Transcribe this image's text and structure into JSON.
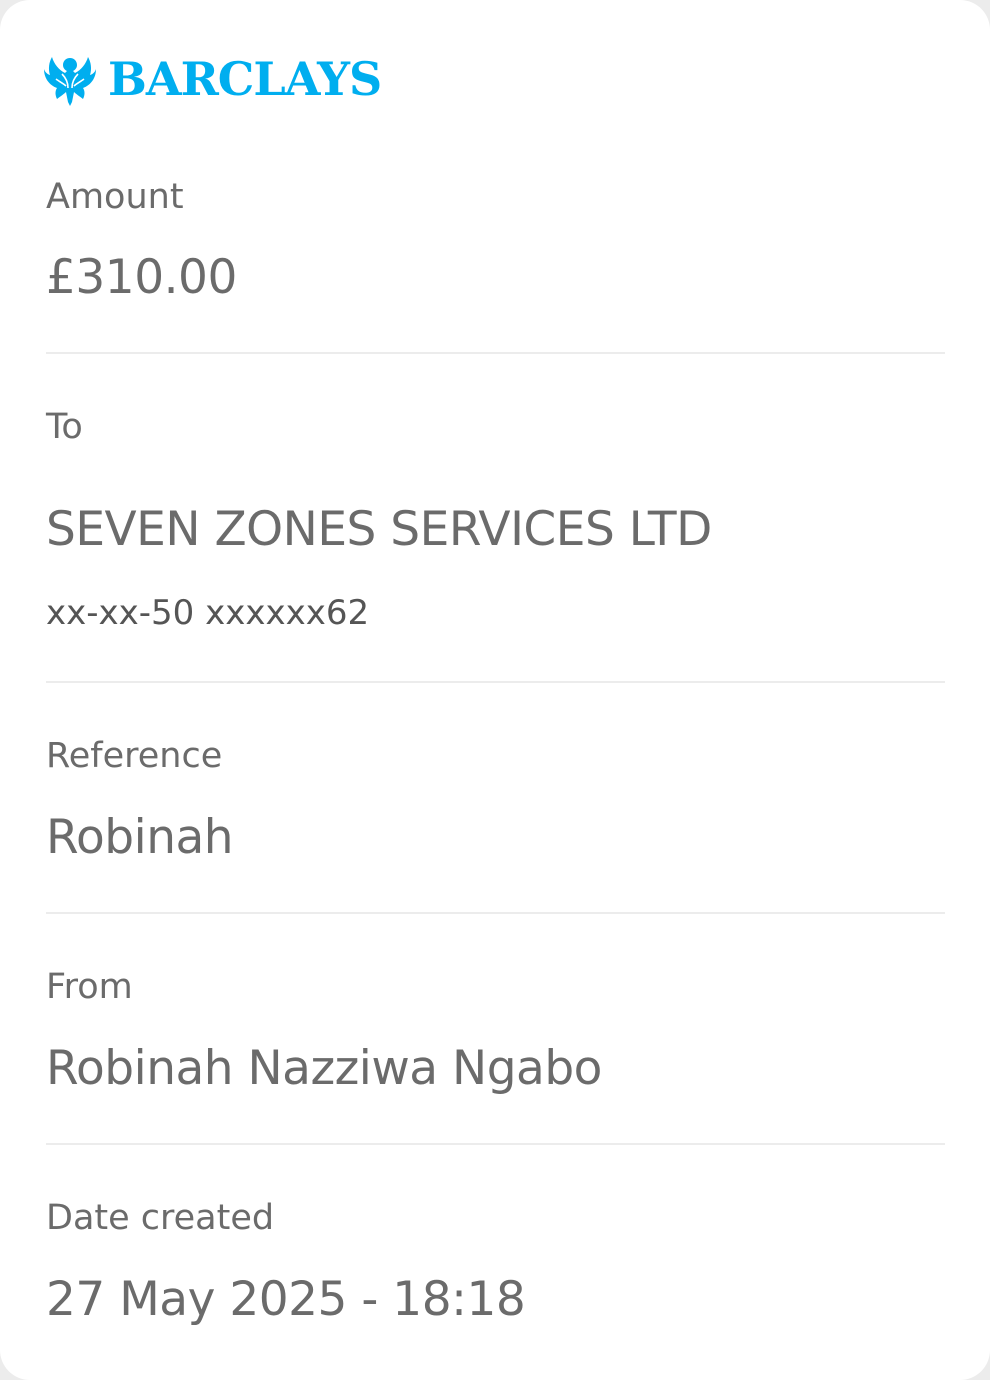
{
  "brand": {
    "name": "BARCLAYS",
    "icon": "eagle-icon",
    "color": "#00aeef"
  },
  "amount": {
    "label": "Amount",
    "value": "£310.00"
  },
  "to": {
    "label": "To",
    "name": "SEVEN ZONES SERVICES LTD",
    "account": "xx-xx-50 xxxxxx62"
  },
  "reference": {
    "label": "Reference",
    "value": "Robinah"
  },
  "from": {
    "label": "From",
    "value": "Robinah Nazziwa Ngabo"
  },
  "date_created": {
    "label": "Date created",
    "value": "27 May 2025 - 18:18"
  }
}
